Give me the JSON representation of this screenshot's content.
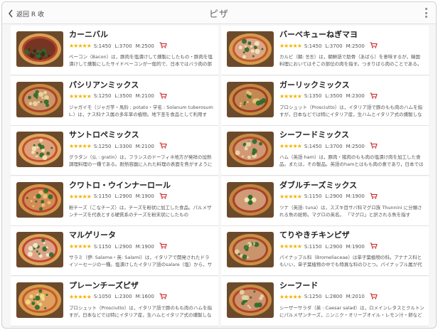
{
  "header": {
    "back_label": "返回 R 收",
    "title": "ピザ"
  },
  "items": [
    {
      "name": "カーニバル",
      "stars": "★★★★★",
      "s": "S:1450",
      "l": "L:3700",
      "m": "M:2500",
      "desc": "ベーコン（Bacon）は，豚肉を塩漬けして燻製にしたもの・豚肉を塩漬けして燻製にしたサイドベーコンが一般的で、日本ではバラ肉の部位を使った物をベーコンと呼ぶ，ショルダーベーコン",
      "colors": {
        "crust": "#d9a056",
        "sauce": "#b8432b",
        "top": "#3d2a1c"
      }
    },
    {
      "name": "バーベキューねぎマヨ",
      "stars": "★★★★★",
      "s": "S:1450",
      "l": "L:3700",
      "m": "M:2500",
      "desc": "カルビ（朝: 동동）は，朝鮮語で肋骨（あばら）を意味するが，韓国料理においてはそこの部位の肉を指す。つまりばら肉のことである。「カルビ」",
      "colors": {
        "crust": "#d79a4b",
        "sauce": "#c35a2d",
        "top": "#f1e6c8"
      }
    },
    {
      "name": "パシリアンミックス",
      "stars": "★★★★★",
      "s": "S:1250",
      "l": "L:3500",
      "m": "M:2100",
      "desc": "ジャガイモ（ジャガ芋・馬鈴 ; potato・学名 : Solanum tuberosum L.）は，ナス科ナス属の多年草の植物。地下茎を食品として利用する。 ジャガイモは",
      "colors": {
        "crust": "#c98a3e",
        "sauce": "#a9432a",
        "top": "#e9d8a0"
      }
    },
    {
      "name": "ガーリックミックス",
      "stars": "★★★★★",
      "s": "S:1350",
      "l": "L:3500",
      "m": "M:2300",
      "desc": "プロシュット（Prosciutto）は，イタリア語で豚のもも肉のハムを指すが，日本などでは特にイタリア産，生ハムとイタリア式の燻製しない生ハムのことを指す",
      "colors": {
        "crust": "#c7883f",
        "sauce": "#9e3f26",
        "top": "#e4c47a"
      }
    },
    {
      "name": "サントロペミックス",
      "stars": "★★★★★",
      "s": "S:1250",
      "l": "L:3300",
      "m": "M:2100",
      "desc": "グラタン（仏 : gratin）は，フランスのドーフィネ地方が発祥の加熱調理料理の一種である。耐熱容器に入れた料理の表面を焦がすように焼いた料理のこと",
      "colors": {
        "crust": "#e0a85d",
        "sauce": "#c4502f",
        "top": "#f3e4b8"
      }
    },
    {
      "name": "シーフードミックス",
      "stars": "★★★★★",
      "s": "S:1450",
      "l": "L:3700",
      "m": "M:2500",
      "desc": "ハム（英語 ham）は，豚肉・猪肉のもも肉の塩漬け肉を加工した食品。または，その製品。英語のhamとはもも肉の意であり，日本では必ずしも豚もも肉",
      "colors": {
        "crust": "#c88b45",
        "sauce": "#b24a2b",
        "top": "#ead9b0"
      }
    },
    {
      "name": "クワトロ・ウインナーロール",
      "stars": "★★★★★",
      "s": "S:1150",
      "l": "L:2900",
      "m": "M:1900",
      "desc": "粉チーズ（こなチーズ）は，チーズを粉状に加工した食品。パルメザンチーズを代表とする硬質系のチーズを粉末状にしたもの",
      "colors": {
        "crust": "#d49648",
        "sauce": "#b8432b",
        "top": "#e8c47a"
      }
    },
    {
      "name": "ダブルチーズミックス",
      "stars": "★★★★★",
      "s": "S:1150",
      "l": "L:2900",
      "m": "M:1900",
      "desc": "ツナ（英語: tuna）は，スズキ目サバ科マグロ族 Thunnini に分類される魚の総称。マグロの英名。 「マグロ」と訳される魚を指す",
      "colors": {
        "crust": "#c2833c",
        "sauce": "#a8402a",
        "top": "#f2e3b4"
      }
    },
    {
      "name": "マルゲリータ",
      "stars": "★★★★★",
      "s": "S:1150",
      "l": "L:2900",
      "m": "M:1900",
      "desc": "サラミ（伊: Salame・英: Salami）は，イタリアで開発されたドライソーセージの一種。塩漬けしたイタリア語のsalare（塩）から，サラミと呼ばれる",
      "colors": {
        "crust": "#dca455",
        "sauce": "#c0472d",
        "top": "#f4ecd0"
      }
    },
    {
      "name": "てりやきチキンピザ",
      "stars": "★★★★★",
      "s": "S:1150",
      "l": "L:2900",
      "m": "M:1900",
      "desc": "パイナップル科（Bromeliaceae）は単子葉植物の科。アナナス科ともいい，単子葉植物の中でも特異な科のひとつ。パイナップル属が代表的な植物",
      "colors": {
        "crust": "#cf8f43",
        "sauce": "#a5482a",
        "top": "#e7d3a2"
      }
    },
    {
      "name": "プレーンチーズピザ",
      "stars": "★★★★★",
      "s": "S:1050",
      "l": "L:2300",
      "m": "M:1600",
      "desc": "プロシュット（Prosciutto）は，イタリア語で豚のもも肉のハムを指すが，日本などでは特にイタリア産，生ハムとイタリア式の燻製しない生ハムのことを指す",
      "colors": {
        "crust": "#d99c4a",
        "sauce": "#c55a2c",
        "top": "#f3dc8c"
      }
    },
    {
      "name": "シーフード",
      "stars": "★★★★★",
      "s": "S:1250",
      "l": "L:2800",
      "m": "M:2010",
      "desc": "シーザーサラダ（英 : Caesar salad）は，ロメインレタスとクルトンにパルメザンチーズ，ニンニク・オリーブオイル・レモン汁・卵などのドレッシングであえたサラダ",
      "colors": {
        "crust": "#c98d44",
        "sauce": "#b14127",
        "top": "#e4d6a8"
      }
    }
  ],
  "icons": {
    "back": "chevron-left-icon",
    "menu": "more-vertical-icon",
    "cart": "shopping-cart-icon",
    "star": "star-icon"
  },
  "accent": "#cc2222"
}
